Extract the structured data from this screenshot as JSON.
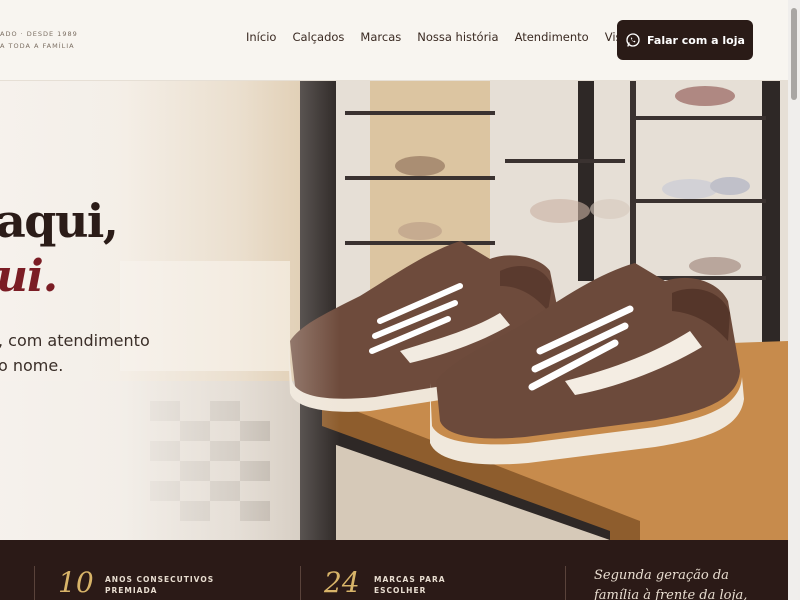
{
  "header": {
    "tagline_line1": "ADO · DESDE 1989",
    "tagline_line2": "A TODA A FAMÍLIA",
    "nav": [
      "Início",
      "Calçados",
      "Marcas",
      "Nossa história",
      "Atendimento",
      "Visite"
    ],
    "cta_label": "Falar com a loja",
    "cta_icon": "whatsapp-icon"
  },
  "hero": {
    "headline_line1": "aqui,",
    "headline_line2": "ui.",
    "subtitle_line1": ", com atendimento",
    "subtitle_line2": "o nome."
  },
  "stats": {
    "items": [
      {
        "number": "10",
        "label_line1": "ANOS CONSECUTIVOS",
        "label_line2": "PREMIADA"
      },
      {
        "number": "24",
        "label_line1": "MARCAS PARA",
        "label_line2": "ESCOLHER"
      }
    ],
    "quote_line1": "Segunda geração da",
    "quote_line2": "família à frente da loja,"
  },
  "colors": {
    "background": "#f7f3ee",
    "dark": "#2b1a17",
    "accent_wine": "#7b1d25",
    "accent_gold": "#d8b469"
  }
}
